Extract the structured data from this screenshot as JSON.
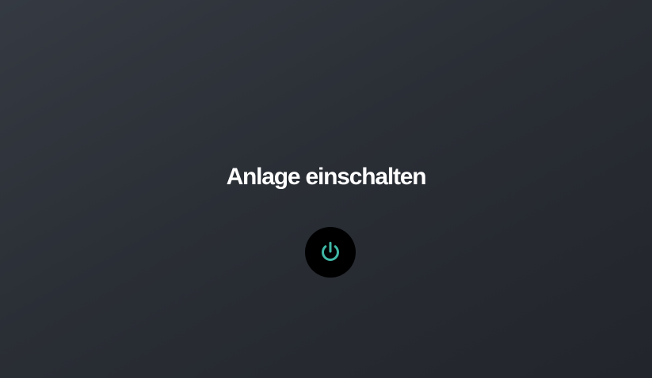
{
  "screen": {
    "title": "Anlage einschalten"
  },
  "power_button": {
    "icon": "power-icon",
    "icon_color": "#3fb8a6"
  },
  "colors": {
    "background_top": "#353a42",
    "background_bottom": "#22252b",
    "title_text": "#ffffff",
    "button_background": "#000000"
  }
}
